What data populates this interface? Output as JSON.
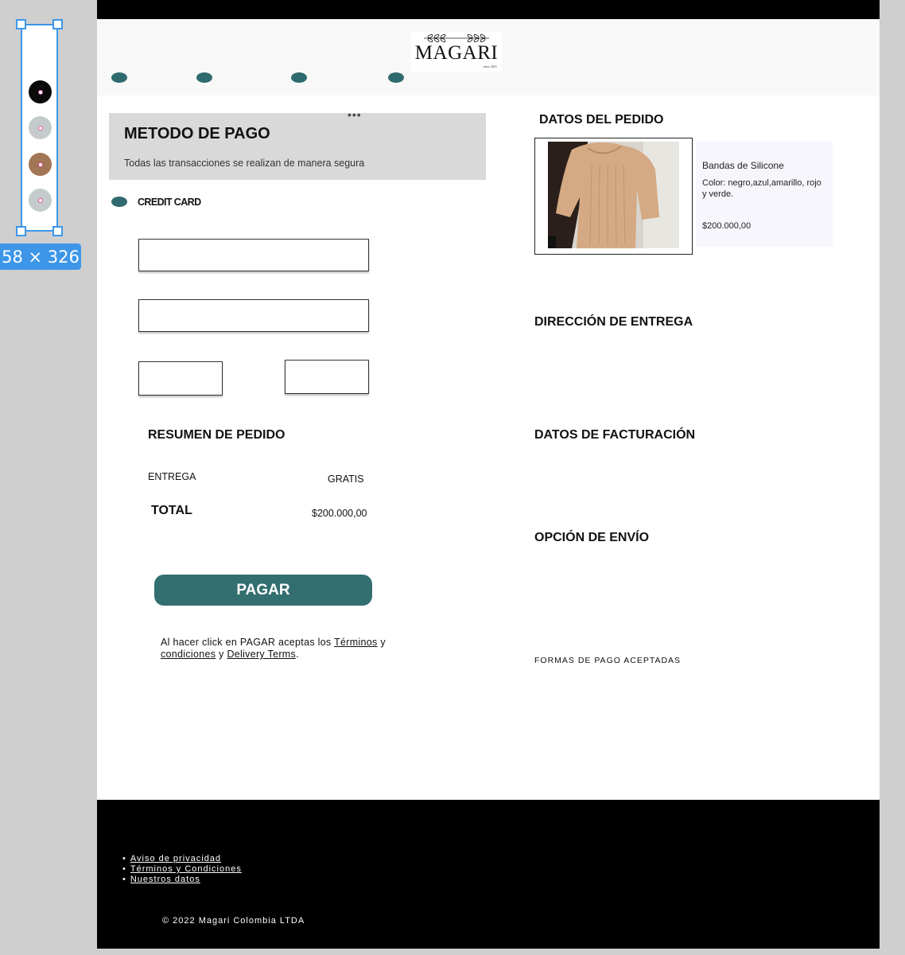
{
  "colors": {
    "accent": "#336e70",
    "header_bg": "#f8f8f8",
    "selection_blue": "#3d96e8",
    "swatches": [
      "#0a0a0a",
      "#c5cbcb",
      "#a27554",
      "#c5cbcb"
    ]
  },
  "selection": {
    "size_label": "58 × 326"
  },
  "header": {
    "logo_text": "MAGARI",
    "logo_since": "since 2021"
  },
  "payment": {
    "title": "METODO DE PAGO",
    "subtitle": "Todas las transacciones se realizan de manera segura",
    "method_label": "CREDIT CARD",
    "card_number": "",
    "card_name": "",
    "card_expiry": "",
    "card_cvv": ""
  },
  "summary": {
    "title": "RESUMEN DE PEDIDO",
    "shipping_label": "ENTREGA",
    "shipping_value": "GRATIS",
    "total_label": "TOTAL",
    "total_value": "$200.000,00",
    "pay_button": "PAGAR"
  },
  "legal": {
    "prefix": "Al hacer click en PAGAR aceptas los ",
    "terms_link": "Términos",
    "mid": " y ",
    "conditions_link": "condiciones",
    "mid2": " y ",
    "delivery_link": "Delivery Terms",
    "suffix": "."
  },
  "order": {
    "title": "DATOS DEL PEDIDO",
    "product_name": "Bandas de Silicone",
    "product_color": "Color: negro,azul,amarillo, rojo y verde.",
    "product_price": "$200.000,00"
  },
  "sections": {
    "delivery_address": "DIRECCIÓN DE ENTREGA",
    "billing": "DATOS DE FACTURACIÓN",
    "shipping_option": "OPCIÓN DE ENVÍO",
    "accepted_payments": "FORMAS DE PAGO ACEPTADAS"
  },
  "footer": {
    "links": [
      "Aviso de privacidad",
      "Términos y Condiciones",
      "Nuestros datos"
    ],
    "copyright": "© 2022 Magari Colombia LTDA"
  }
}
